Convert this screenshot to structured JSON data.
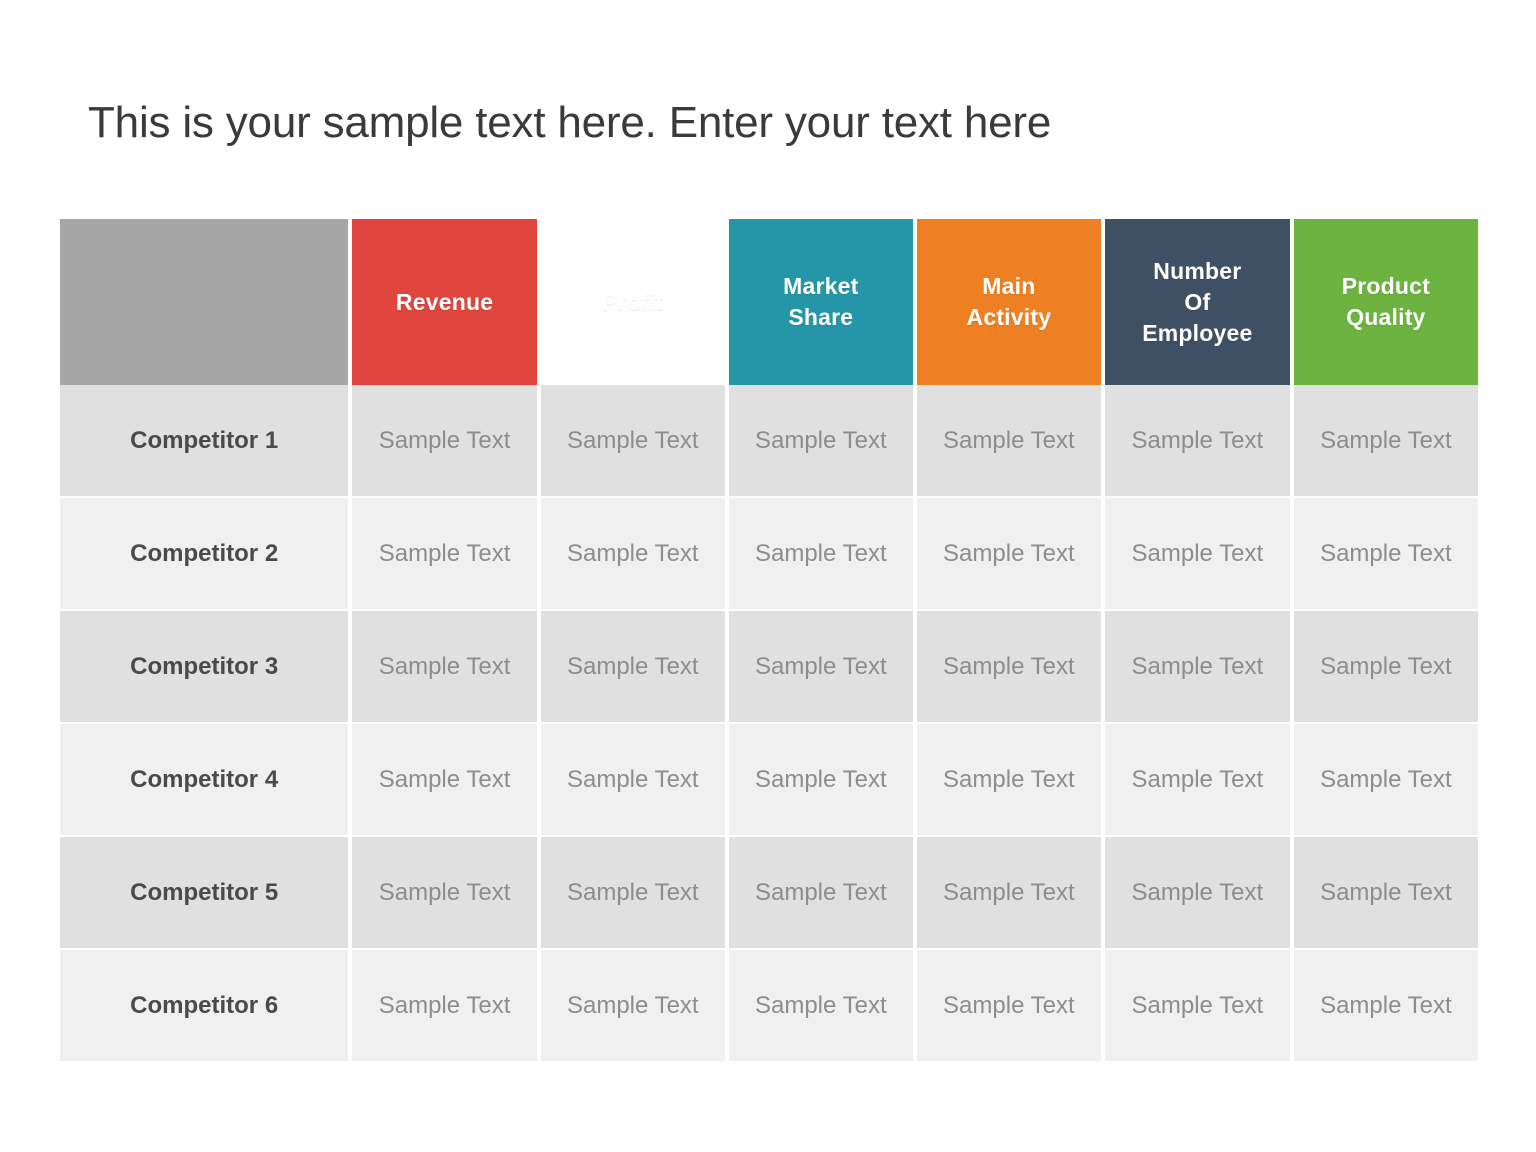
{
  "slide": {
    "title": "This is your sample text here. Enter your text here",
    "background_color": "#ffffff"
  },
  "table": {
    "corner_label": "",
    "corner_color": "#a6a6a6",
    "columns": [
      {
        "label": "Revenue",
        "lines": [
          "Revenue"
        ],
        "color": "#e0453e"
      },
      {
        "label": "Profit",
        "lines": [
          "Profit"
        ],
        "color": "#f5c council"
      },
      {
        "label": "Market Share",
        "lines": [
          "Market",
          "Share"
        ],
        "color": "#2596a8"
      },
      {
        "label": "Main Activity",
        "lines": [
          "Main",
          "Activity"
        ],
        "color": "#ee8023"
      },
      {
        "label": "Number Of Employee",
        "lines": [
          "Number",
          "Of",
          "Employee"
        ],
        "color": "#3e5164"
      },
      {
        "label": "Product Quality",
        "lines": [
          "Product",
          "Quality"
        ],
        "color": "#6cb33f"
      }
    ],
    "rows": [
      {
        "label": "Competitor 1",
        "values": [
          "Sample Text",
          "Sample Text",
          "Sample Text",
          "Sample Text",
          "Sample Text",
          "Sample Text"
        ]
      },
      {
        "label": "Competitor 2",
        "values": [
          "Sample Text",
          "Sample Text",
          "Sample Text",
          "Sample Text",
          "Sample Text",
          "Sample Text"
        ]
      },
      {
        "label": "Competitor 3",
        "values": [
          "Sample Text",
          "Sample Text",
          "Sample Text",
          "Sample Text",
          "Sample Text",
          "Sample Text"
        ]
      },
      {
        "label": "Competitor 4",
        "values": [
          "Sample Text",
          "Sample Text",
          "Sample Text",
          "Sample Text",
          "Sample Text",
          "Sample Text"
        ]
      },
      {
        "label": "Competitor 5",
        "values": [
          "Sample Text",
          "Sample Text",
          "Sample Text",
          "Sample Text",
          "Sample Text",
          "Sample Text"
        ]
      },
      {
        "label": "Competitor 6",
        "values": [
          "Sample Text",
          "Sample Text",
          "Sample Text",
          "Sample Text",
          "Sample Text",
          "Sample Text"
        ]
      }
    ],
    "row_colors": {
      "odd": "#e0e0e0",
      "even": "#f0f0f0"
    },
    "label_text_color": "#4a4a4a",
    "value_text_color": "#8d8d8d"
  }
}
